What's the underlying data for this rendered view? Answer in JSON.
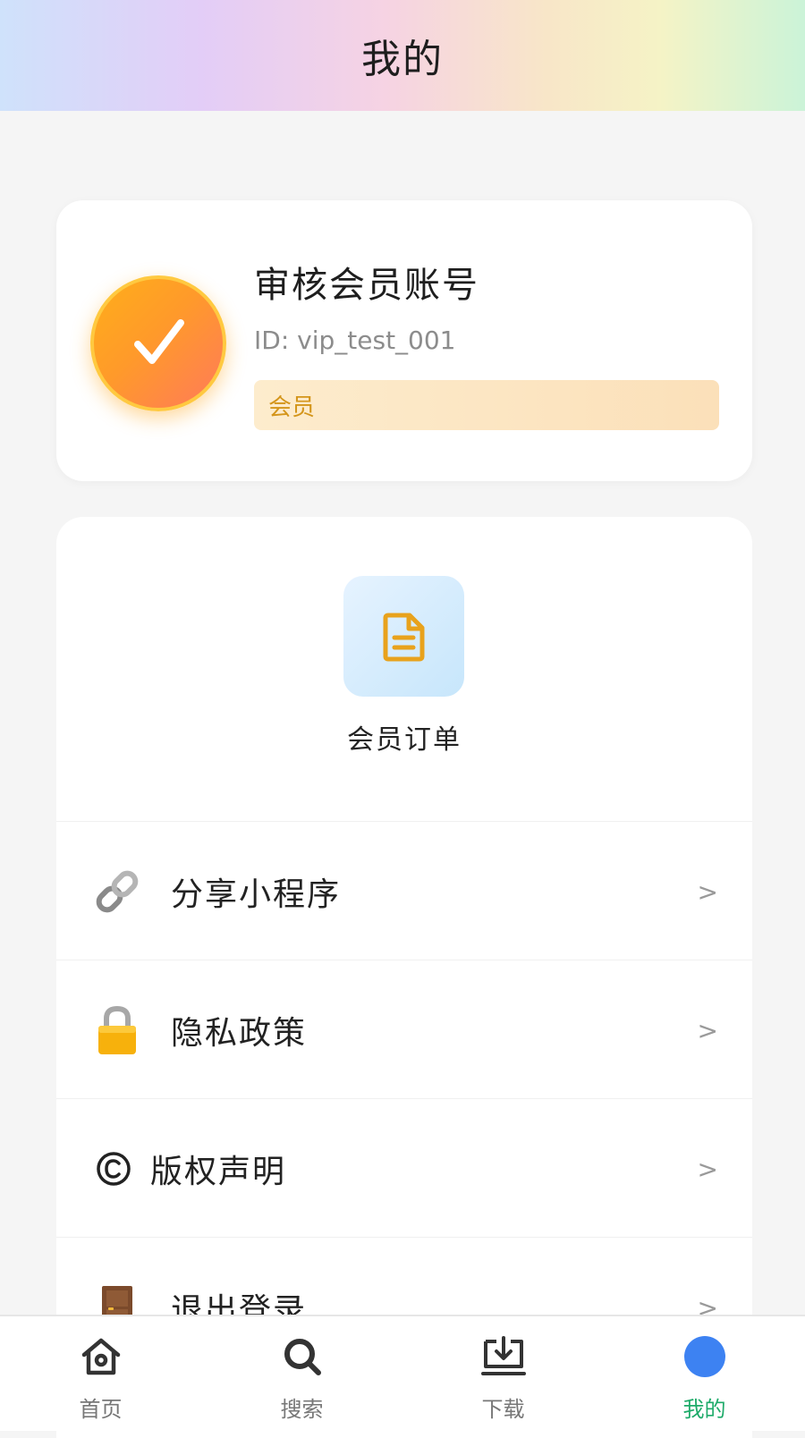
{
  "header": {
    "title": "我的"
  },
  "profile": {
    "name": "审核会员账号",
    "id_text": "ID: vip_test_001",
    "badge": "会员"
  },
  "orders": {
    "label": "会员订单",
    "icon": "document-icon"
  },
  "menu": {
    "items": [
      {
        "label": "分享小程序",
        "icon": "link-icon",
        "chevron": ">"
      },
      {
        "label": "隐私政策",
        "icon": "lock-icon",
        "chevron": ">"
      },
      {
        "label": "版权声明",
        "icon": "copyright-icon",
        "chevron": ">"
      },
      {
        "label": "退出登录",
        "icon": "door-icon",
        "chevron": ">"
      }
    ]
  },
  "tabbar": {
    "items": [
      {
        "label": "首页",
        "icon": "home-icon",
        "active": false
      },
      {
        "label": "搜索",
        "icon": "search-icon",
        "active": false
      },
      {
        "label": "下载",
        "icon": "download-icon",
        "active": false
      },
      {
        "label": "我的",
        "icon": "profile-dot-icon",
        "active": true
      }
    ]
  },
  "colors": {
    "accent_green": "#1fab6a",
    "active_blue": "#3d82f2",
    "badge_text": "#d4951a",
    "avatar_orange": "#ff9a2a"
  }
}
